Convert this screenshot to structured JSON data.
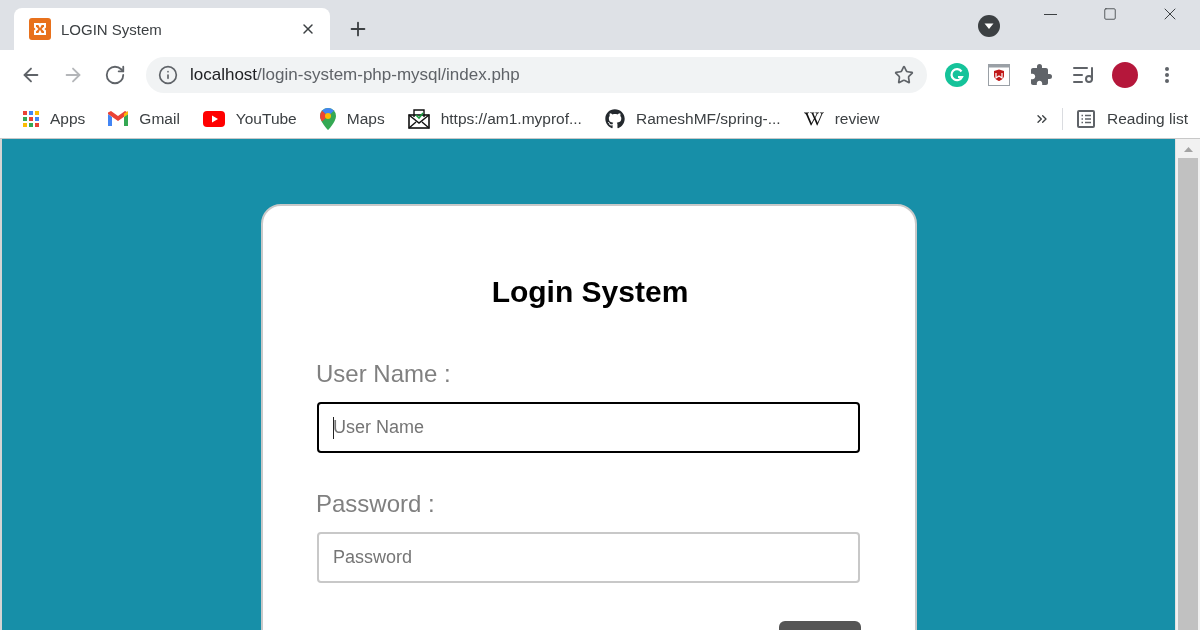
{
  "browser": {
    "tabs": [
      {
        "title": "LOGIN System",
        "selected": true
      }
    ],
    "nav_buttons": [
      {
        "disabled": false
      },
      {
        "disabled": true
      },
      {
        "disabled": false
      }
    ],
    "address_bar": {
      "host": "localhost",
      "path": "/login-system-php-mysql/index.php"
    },
    "bookmarks": [
      {
        "label": "Apps"
      },
      {
        "label": "Gmail"
      },
      {
        "label": "YouTube"
      },
      {
        "label": "Maps"
      },
      {
        "label": "https://am1.myprof..."
      },
      {
        "label": "RameshMF/spring-..."
      },
      {
        "label": "review"
      }
    ],
    "reading_list": "Reading list"
  },
  "page": {
    "title": "Login System",
    "fields": [
      {
        "label": "User Name :",
        "placeholder": "User Name",
        "focused": true
      },
      {
        "label": "Password :",
        "placeholder": "Password",
        "focused": false
      }
    ]
  }
}
